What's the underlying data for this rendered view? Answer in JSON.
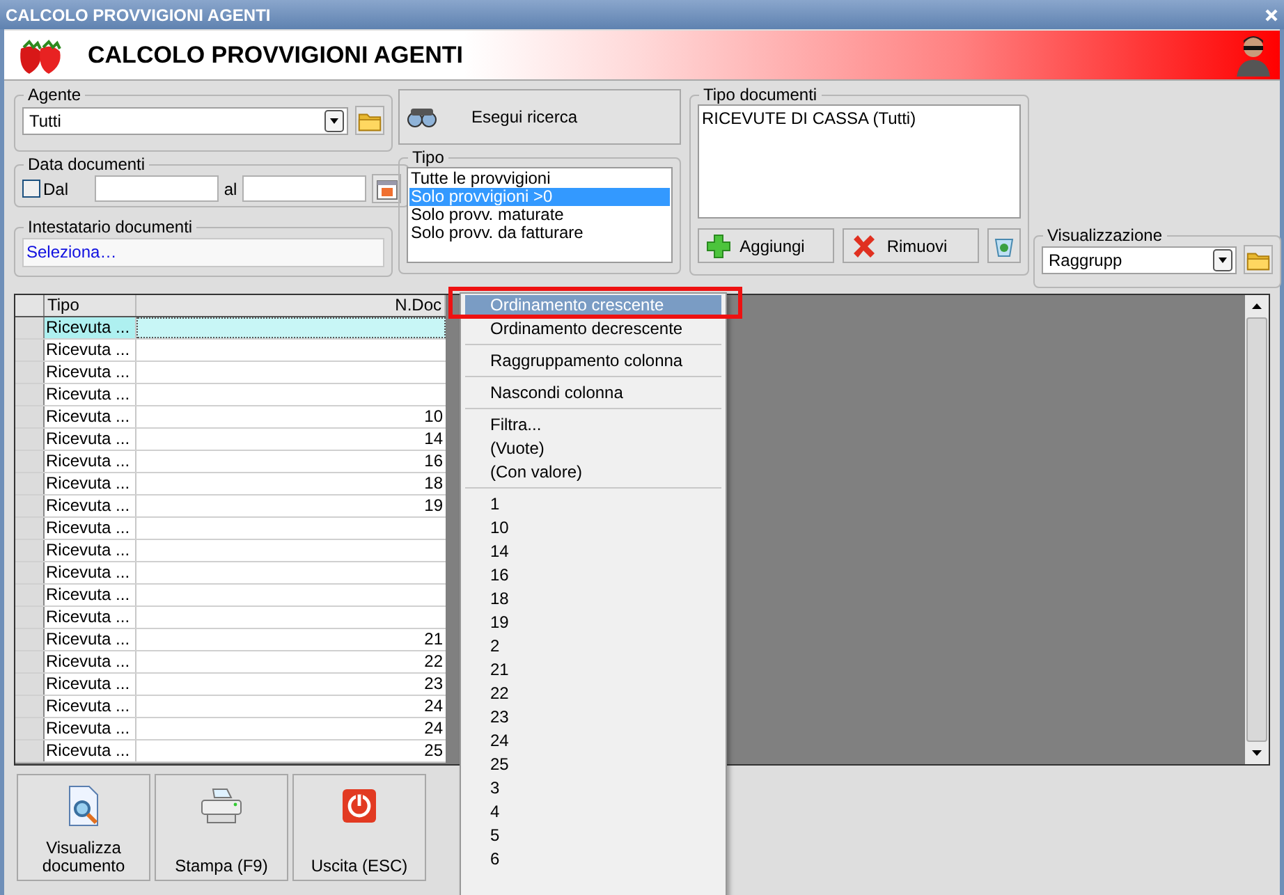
{
  "window": {
    "title": "CALCOLO PROVVIGIONI AGENTI"
  },
  "header": {
    "title": "CALCOLO PROVVIGIONI AGENTI"
  },
  "agente": {
    "label": "Agente",
    "value": "Tutti"
  },
  "search_button": "Esegui ricerca",
  "data_documenti": {
    "label": "Data documenti",
    "checkbox": {
      "label": "Dal",
      "checked": false
    },
    "to_label": "al"
  },
  "intestatario": {
    "label": "Intestatario documenti",
    "value": "Seleziona…"
  },
  "tipo": {
    "label": "Tipo",
    "options": [
      {
        "label": "Tutte le provvigioni",
        "selected": false
      },
      {
        "label": "Solo provvigioni >0",
        "selected": true
      },
      {
        "label": "Solo provv. maturate",
        "selected": false
      },
      {
        "label": "Solo provv. da fatturare",
        "selected": false
      }
    ]
  },
  "tipo_documenti": {
    "label": "Tipo documenti",
    "items": [
      "RICEVUTE DI CASSA (Tutti)"
    ],
    "buttons": [
      "Aggiungi",
      "Rimuovi"
    ]
  },
  "visualizzazione": {
    "label": "Visualizzazione",
    "value": "Raggrupp"
  },
  "table": {
    "columns": [
      "Tipo",
      "N.Doc"
    ],
    "rows": [
      {
        "tipo": "Ricevuta ...",
        "selected": true
      },
      {
        "tipo": "Ricevuta ...",
        "selected": false
      },
      {
        "tipo": "Ricevuta ...",
        "selected": false
      },
      {
        "tipo": "Ricevuta ...",
        "selected": false
      },
      {
        "tipo": "Ricevuta ...",
        "n_doc": "10",
        "selected": false
      },
      {
        "tipo": "Ricevuta ...",
        "n_doc": "14",
        "selected": false
      },
      {
        "tipo": "Ricevuta ...",
        "n_doc": "16",
        "selected": false
      },
      {
        "tipo": "Ricevuta ...",
        "n_doc": "18",
        "selected": false
      },
      {
        "tipo": "Ricevuta ...",
        "n_doc": "19",
        "selected": false
      },
      {
        "tipo": "Ricevuta ...",
        "selected": false
      },
      {
        "tipo": "Ricevuta ...",
        "selected": false
      },
      {
        "tipo": "Ricevuta ...",
        "selected": false
      },
      {
        "tipo": "Ricevuta ...",
        "selected": false
      },
      {
        "tipo": "Ricevuta ...",
        "selected": false
      },
      {
        "tipo": "Ricevuta ...",
        "n_doc": "21",
        "selected": false
      },
      {
        "tipo": "Ricevuta ...",
        "n_doc": "22",
        "selected": false
      },
      {
        "tipo": "Ricevuta ...",
        "n_doc": "23",
        "selected": false
      },
      {
        "tipo": "Ricevuta ...",
        "n_doc": "24",
        "selected": false
      },
      {
        "tipo": "Ricevuta ...",
        "n_doc": "24",
        "selected": false
      },
      {
        "tipo": "Ricevuta ...",
        "n_doc": "25",
        "selected": false
      }
    ]
  },
  "context_menu": {
    "items": [
      {
        "kind": "item",
        "label": "Ordinamento crescente",
        "selected": true
      },
      {
        "kind": "item",
        "label": "Ordinamento decrescente",
        "selected": false
      },
      {
        "kind": "separator"
      },
      {
        "kind": "item",
        "label": "Raggruppamento colonna",
        "selected": false
      },
      {
        "kind": "separator"
      },
      {
        "kind": "item",
        "label": "Nascondi colonna",
        "selected": false
      },
      {
        "kind": "separator"
      },
      {
        "kind": "item",
        "label": "Filtra...",
        "selected": false
      },
      {
        "kind": "item",
        "label": "(Vuote)",
        "selected": false
      },
      {
        "kind": "item",
        "label": "(Con valore)",
        "selected": false
      },
      {
        "kind": "separator"
      },
      {
        "kind": "item",
        "label": "1",
        "selected": false
      },
      {
        "kind": "item",
        "label": "10",
        "selected": false
      },
      {
        "kind": "item",
        "label": "14",
        "selected": false
      },
      {
        "kind": "item",
        "label": "16",
        "selected": false
      },
      {
        "kind": "item",
        "label": "18",
        "selected": false
      },
      {
        "kind": "item",
        "label": "19",
        "selected": false
      },
      {
        "kind": "item",
        "label": "2",
        "selected": false
      },
      {
        "kind": "item",
        "label": "21",
        "selected": false
      },
      {
        "kind": "item",
        "label": "22",
        "selected": false
      },
      {
        "kind": "item",
        "label": "23",
        "selected": false
      },
      {
        "kind": "item",
        "label": "24",
        "selected": false
      },
      {
        "kind": "item",
        "label": "25",
        "selected": false
      },
      {
        "kind": "item",
        "label": "3",
        "selected": false
      },
      {
        "kind": "item",
        "label": "4",
        "selected": false
      },
      {
        "kind": "item",
        "label": "5",
        "selected": false
      },
      {
        "kind": "item",
        "label": "6",
        "selected": false
      }
    ]
  },
  "bottom_buttons": [
    "Visualizza documento",
    "Stampa (F9)",
    "Uscita (ESC)"
  ]
}
